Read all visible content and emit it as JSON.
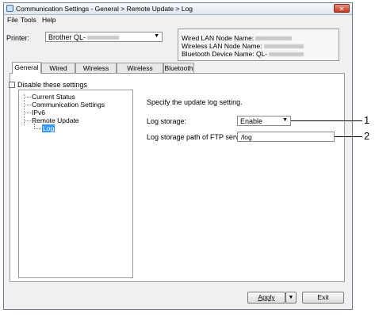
{
  "window": {
    "title": "Communication Settings - General > Remote Update > Log",
    "close_glyph": "✕"
  },
  "menu": [
    "File",
    "Tools",
    "Help"
  ],
  "printer": {
    "label": "Printer:",
    "value": "Brother QL-",
    "dropdown_glyph": "▼"
  },
  "info": {
    "wired": "Wired LAN Node Name:",
    "wireless": "Wireless LAN Node Name:",
    "bluetooth": "Bluetooth Device Name: QL-"
  },
  "tabs": [
    "General",
    "Wired LAN",
    "Wireless LAN",
    "Wireless Direct",
    "Bluetooth"
  ],
  "active_tab": "General",
  "disable": {
    "label": "Disable these settings",
    "checked": false
  },
  "tree": [
    "Current Status",
    "Communication Settings",
    "IPv6",
    "Remote Update",
    "Log"
  ],
  "content": {
    "description": "Specify the update log setting.",
    "log_storage_label": "Log storage:",
    "log_storage_value": "Enable",
    "log_path_label": "Log storage path of FTP server:",
    "log_path_value": "/log"
  },
  "callouts": [
    "1",
    "2"
  ],
  "buttons": {
    "apply": "Apply",
    "exit": "Exit",
    "apply_menu_glyph": "▼"
  },
  "colors": {
    "selection": "#3399ff",
    "close": "#c2391f"
  }
}
